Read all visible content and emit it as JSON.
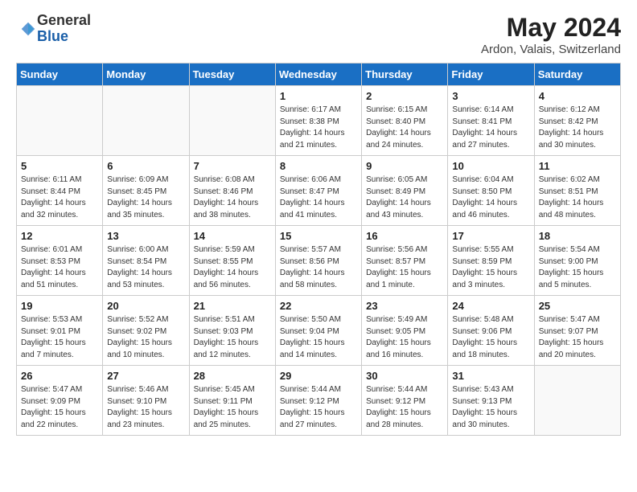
{
  "header": {
    "logo_general": "General",
    "logo_blue": "Blue",
    "month_year": "May 2024",
    "location": "Ardon, Valais, Switzerland"
  },
  "days_of_week": [
    "Sunday",
    "Monday",
    "Tuesday",
    "Wednesday",
    "Thursday",
    "Friday",
    "Saturday"
  ],
  "weeks": [
    [
      {
        "day": "",
        "info": ""
      },
      {
        "day": "",
        "info": ""
      },
      {
        "day": "",
        "info": ""
      },
      {
        "day": "1",
        "info": "Sunrise: 6:17 AM\nSunset: 8:38 PM\nDaylight: 14 hours\nand 21 minutes."
      },
      {
        "day": "2",
        "info": "Sunrise: 6:15 AM\nSunset: 8:40 PM\nDaylight: 14 hours\nand 24 minutes."
      },
      {
        "day": "3",
        "info": "Sunrise: 6:14 AM\nSunset: 8:41 PM\nDaylight: 14 hours\nand 27 minutes."
      },
      {
        "day": "4",
        "info": "Sunrise: 6:12 AM\nSunset: 8:42 PM\nDaylight: 14 hours\nand 30 minutes."
      }
    ],
    [
      {
        "day": "5",
        "info": "Sunrise: 6:11 AM\nSunset: 8:44 PM\nDaylight: 14 hours\nand 32 minutes."
      },
      {
        "day": "6",
        "info": "Sunrise: 6:09 AM\nSunset: 8:45 PM\nDaylight: 14 hours\nand 35 minutes."
      },
      {
        "day": "7",
        "info": "Sunrise: 6:08 AM\nSunset: 8:46 PM\nDaylight: 14 hours\nand 38 minutes."
      },
      {
        "day": "8",
        "info": "Sunrise: 6:06 AM\nSunset: 8:47 PM\nDaylight: 14 hours\nand 41 minutes."
      },
      {
        "day": "9",
        "info": "Sunrise: 6:05 AM\nSunset: 8:49 PM\nDaylight: 14 hours\nand 43 minutes."
      },
      {
        "day": "10",
        "info": "Sunrise: 6:04 AM\nSunset: 8:50 PM\nDaylight: 14 hours\nand 46 minutes."
      },
      {
        "day": "11",
        "info": "Sunrise: 6:02 AM\nSunset: 8:51 PM\nDaylight: 14 hours\nand 48 minutes."
      }
    ],
    [
      {
        "day": "12",
        "info": "Sunrise: 6:01 AM\nSunset: 8:53 PM\nDaylight: 14 hours\nand 51 minutes."
      },
      {
        "day": "13",
        "info": "Sunrise: 6:00 AM\nSunset: 8:54 PM\nDaylight: 14 hours\nand 53 minutes."
      },
      {
        "day": "14",
        "info": "Sunrise: 5:59 AM\nSunset: 8:55 PM\nDaylight: 14 hours\nand 56 minutes."
      },
      {
        "day": "15",
        "info": "Sunrise: 5:57 AM\nSunset: 8:56 PM\nDaylight: 14 hours\nand 58 minutes."
      },
      {
        "day": "16",
        "info": "Sunrise: 5:56 AM\nSunset: 8:57 PM\nDaylight: 15 hours\nand 1 minute."
      },
      {
        "day": "17",
        "info": "Sunrise: 5:55 AM\nSunset: 8:59 PM\nDaylight: 15 hours\nand 3 minutes."
      },
      {
        "day": "18",
        "info": "Sunrise: 5:54 AM\nSunset: 9:00 PM\nDaylight: 15 hours\nand 5 minutes."
      }
    ],
    [
      {
        "day": "19",
        "info": "Sunrise: 5:53 AM\nSunset: 9:01 PM\nDaylight: 15 hours\nand 7 minutes."
      },
      {
        "day": "20",
        "info": "Sunrise: 5:52 AM\nSunset: 9:02 PM\nDaylight: 15 hours\nand 10 minutes."
      },
      {
        "day": "21",
        "info": "Sunrise: 5:51 AM\nSunset: 9:03 PM\nDaylight: 15 hours\nand 12 minutes."
      },
      {
        "day": "22",
        "info": "Sunrise: 5:50 AM\nSunset: 9:04 PM\nDaylight: 15 hours\nand 14 minutes."
      },
      {
        "day": "23",
        "info": "Sunrise: 5:49 AM\nSunset: 9:05 PM\nDaylight: 15 hours\nand 16 minutes."
      },
      {
        "day": "24",
        "info": "Sunrise: 5:48 AM\nSunset: 9:06 PM\nDaylight: 15 hours\nand 18 minutes."
      },
      {
        "day": "25",
        "info": "Sunrise: 5:47 AM\nSunset: 9:07 PM\nDaylight: 15 hours\nand 20 minutes."
      }
    ],
    [
      {
        "day": "26",
        "info": "Sunrise: 5:47 AM\nSunset: 9:09 PM\nDaylight: 15 hours\nand 22 minutes."
      },
      {
        "day": "27",
        "info": "Sunrise: 5:46 AM\nSunset: 9:10 PM\nDaylight: 15 hours\nand 23 minutes."
      },
      {
        "day": "28",
        "info": "Sunrise: 5:45 AM\nSunset: 9:11 PM\nDaylight: 15 hours\nand 25 minutes."
      },
      {
        "day": "29",
        "info": "Sunrise: 5:44 AM\nSunset: 9:12 PM\nDaylight: 15 hours\nand 27 minutes."
      },
      {
        "day": "30",
        "info": "Sunrise: 5:44 AM\nSunset: 9:12 PM\nDaylight: 15 hours\nand 28 minutes."
      },
      {
        "day": "31",
        "info": "Sunrise: 5:43 AM\nSunset: 9:13 PM\nDaylight: 15 hours\nand 30 minutes."
      },
      {
        "day": "",
        "info": ""
      }
    ]
  ]
}
